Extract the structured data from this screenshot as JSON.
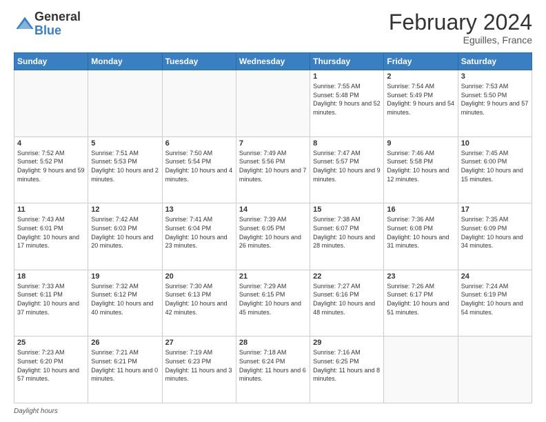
{
  "header": {
    "logo_general": "General",
    "logo_blue": "Blue",
    "title": "February 2024",
    "subtitle": "Eguilles, France"
  },
  "days_of_week": [
    "Sunday",
    "Monday",
    "Tuesday",
    "Wednesday",
    "Thursday",
    "Friday",
    "Saturday"
  ],
  "weeks": [
    [
      {
        "day": "",
        "empty": true
      },
      {
        "day": "",
        "empty": true
      },
      {
        "day": "",
        "empty": true
      },
      {
        "day": "",
        "empty": true
      },
      {
        "day": "1",
        "sunrise": "Sunrise: 7:55 AM",
        "sunset": "Sunset: 5:48 PM",
        "daylight": "Daylight: 9 hours and 52 minutes."
      },
      {
        "day": "2",
        "sunrise": "Sunrise: 7:54 AM",
        "sunset": "Sunset: 5:49 PM",
        "daylight": "Daylight: 9 hours and 54 minutes."
      },
      {
        "day": "3",
        "sunrise": "Sunrise: 7:53 AM",
        "sunset": "Sunset: 5:50 PM",
        "daylight": "Daylight: 9 hours and 57 minutes."
      }
    ],
    [
      {
        "day": "4",
        "sunrise": "Sunrise: 7:52 AM",
        "sunset": "Sunset: 5:52 PM",
        "daylight": "Daylight: 9 hours and 59 minutes."
      },
      {
        "day": "5",
        "sunrise": "Sunrise: 7:51 AM",
        "sunset": "Sunset: 5:53 PM",
        "daylight": "Daylight: 10 hours and 2 minutes."
      },
      {
        "day": "6",
        "sunrise": "Sunrise: 7:50 AM",
        "sunset": "Sunset: 5:54 PM",
        "daylight": "Daylight: 10 hours and 4 minutes."
      },
      {
        "day": "7",
        "sunrise": "Sunrise: 7:49 AM",
        "sunset": "Sunset: 5:56 PM",
        "daylight": "Daylight: 10 hours and 7 minutes."
      },
      {
        "day": "8",
        "sunrise": "Sunrise: 7:47 AM",
        "sunset": "Sunset: 5:57 PM",
        "daylight": "Daylight: 10 hours and 9 minutes."
      },
      {
        "day": "9",
        "sunrise": "Sunrise: 7:46 AM",
        "sunset": "Sunset: 5:58 PM",
        "daylight": "Daylight: 10 hours and 12 minutes."
      },
      {
        "day": "10",
        "sunrise": "Sunrise: 7:45 AM",
        "sunset": "Sunset: 6:00 PM",
        "daylight": "Daylight: 10 hours and 15 minutes."
      }
    ],
    [
      {
        "day": "11",
        "sunrise": "Sunrise: 7:43 AM",
        "sunset": "Sunset: 6:01 PM",
        "daylight": "Daylight: 10 hours and 17 minutes."
      },
      {
        "day": "12",
        "sunrise": "Sunrise: 7:42 AM",
        "sunset": "Sunset: 6:03 PM",
        "daylight": "Daylight: 10 hours and 20 minutes."
      },
      {
        "day": "13",
        "sunrise": "Sunrise: 7:41 AM",
        "sunset": "Sunset: 6:04 PM",
        "daylight": "Daylight: 10 hours and 23 minutes."
      },
      {
        "day": "14",
        "sunrise": "Sunrise: 7:39 AM",
        "sunset": "Sunset: 6:05 PM",
        "daylight": "Daylight: 10 hours and 26 minutes."
      },
      {
        "day": "15",
        "sunrise": "Sunrise: 7:38 AM",
        "sunset": "Sunset: 6:07 PM",
        "daylight": "Daylight: 10 hours and 28 minutes."
      },
      {
        "day": "16",
        "sunrise": "Sunrise: 7:36 AM",
        "sunset": "Sunset: 6:08 PM",
        "daylight": "Daylight: 10 hours and 31 minutes."
      },
      {
        "day": "17",
        "sunrise": "Sunrise: 7:35 AM",
        "sunset": "Sunset: 6:09 PM",
        "daylight": "Daylight: 10 hours and 34 minutes."
      }
    ],
    [
      {
        "day": "18",
        "sunrise": "Sunrise: 7:33 AM",
        "sunset": "Sunset: 6:11 PM",
        "daylight": "Daylight: 10 hours and 37 minutes."
      },
      {
        "day": "19",
        "sunrise": "Sunrise: 7:32 AM",
        "sunset": "Sunset: 6:12 PM",
        "daylight": "Daylight: 10 hours and 40 minutes."
      },
      {
        "day": "20",
        "sunrise": "Sunrise: 7:30 AM",
        "sunset": "Sunset: 6:13 PM",
        "daylight": "Daylight: 10 hours and 42 minutes."
      },
      {
        "day": "21",
        "sunrise": "Sunrise: 7:29 AM",
        "sunset": "Sunset: 6:15 PM",
        "daylight": "Daylight: 10 hours and 45 minutes."
      },
      {
        "day": "22",
        "sunrise": "Sunrise: 7:27 AM",
        "sunset": "Sunset: 6:16 PM",
        "daylight": "Daylight: 10 hours and 48 minutes."
      },
      {
        "day": "23",
        "sunrise": "Sunrise: 7:26 AM",
        "sunset": "Sunset: 6:17 PM",
        "daylight": "Daylight: 10 hours and 51 minutes."
      },
      {
        "day": "24",
        "sunrise": "Sunrise: 7:24 AM",
        "sunset": "Sunset: 6:19 PM",
        "daylight": "Daylight: 10 hours and 54 minutes."
      }
    ],
    [
      {
        "day": "25",
        "sunrise": "Sunrise: 7:23 AM",
        "sunset": "Sunset: 6:20 PM",
        "daylight": "Daylight: 10 hours and 57 minutes."
      },
      {
        "day": "26",
        "sunrise": "Sunrise: 7:21 AM",
        "sunset": "Sunset: 6:21 PM",
        "daylight": "Daylight: 11 hours and 0 minutes."
      },
      {
        "day": "27",
        "sunrise": "Sunrise: 7:19 AM",
        "sunset": "Sunset: 6:23 PM",
        "daylight": "Daylight: 11 hours and 3 minutes."
      },
      {
        "day": "28",
        "sunrise": "Sunrise: 7:18 AM",
        "sunset": "Sunset: 6:24 PM",
        "daylight": "Daylight: 11 hours and 6 minutes."
      },
      {
        "day": "29",
        "sunrise": "Sunrise: 7:16 AM",
        "sunset": "Sunset: 6:25 PM",
        "daylight": "Daylight: 11 hours and 8 minutes."
      },
      {
        "day": "",
        "empty": true
      },
      {
        "day": "",
        "empty": true
      }
    ]
  ],
  "footer": {
    "label": "Daylight hours"
  }
}
